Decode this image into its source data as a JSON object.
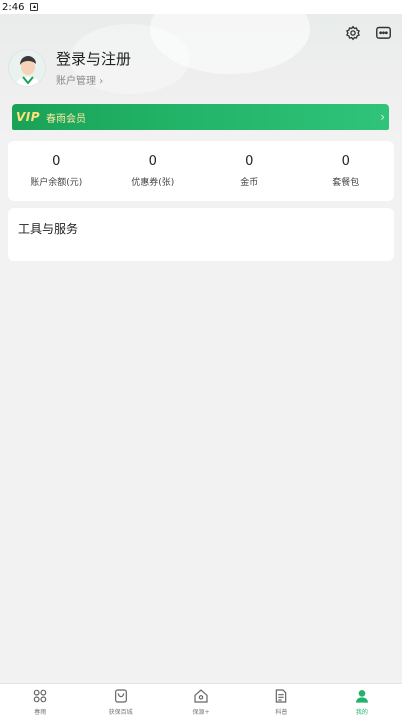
{
  "status_bar": {
    "time": "2:46"
  },
  "header": {},
  "profile": {
    "name": "登录与注册",
    "sub_label": "账户管理",
    "sub_arrow": "›"
  },
  "vip": {
    "logo": "VIP",
    "label": "春雨会员",
    "arrow": "›"
  },
  "stats": [
    {
      "value": "0",
      "label": "账户余额(元)"
    },
    {
      "value": "0",
      "label": "优惠券(张)"
    },
    {
      "value": "0",
      "label": "金币"
    },
    {
      "value": "0",
      "label": "套餐包"
    }
  ],
  "tools": {
    "title": "工具与服务"
  },
  "nav": [
    {
      "label": "春雨"
    },
    {
      "label": "获保百城"
    },
    {
      "label": "保源+"
    },
    {
      "label": "科普"
    },
    {
      "label": "我的"
    }
  ],
  "colors": {
    "accent": "#21b26b",
    "vip_gold": "#ffe27a",
    "background": "#f2f2f2"
  }
}
